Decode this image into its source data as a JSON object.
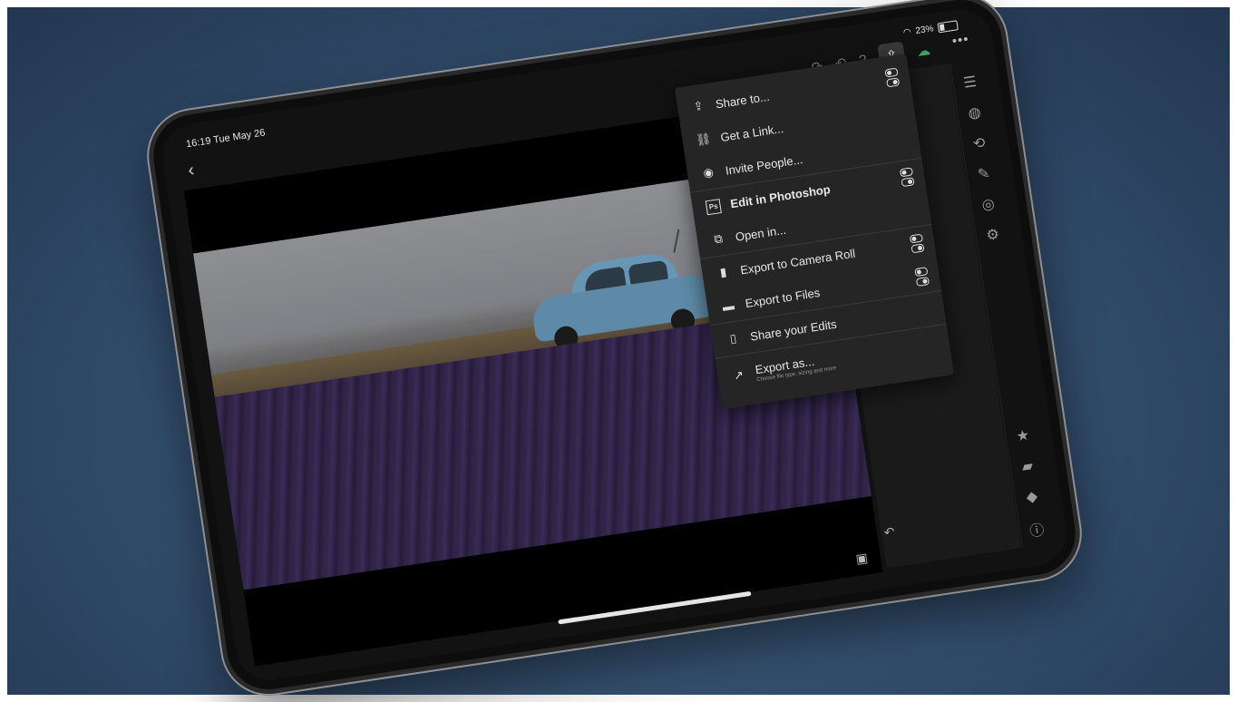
{
  "status": {
    "time": "16:19",
    "date": "Tue May 26",
    "battery": "23%"
  },
  "toolbar": {
    "redo": "↷",
    "undo": "↶",
    "help": "?",
    "share": "⇪",
    "more": "•••"
  },
  "menu": {
    "items": [
      {
        "label": "Share to...",
        "icon": "share-icon",
        "glyph": "⇪"
      },
      {
        "label": "Get a Link...",
        "icon": "link-icon",
        "glyph": "⛓"
      },
      {
        "label": "Invite People...",
        "icon": "invite-people-icon",
        "glyph": "◉"
      },
      {
        "label": "Edit in Photoshop",
        "icon": "photoshop-icon",
        "glyph": "Ps"
      },
      {
        "label": "Open in...",
        "icon": "open-in-icon",
        "glyph": "⧉"
      },
      {
        "label": "Export to Camera Roll",
        "icon": "camera-roll-icon",
        "glyph": "▮"
      },
      {
        "label": "Export to Files",
        "icon": "folder-icon",
        "glyph": "▬"
      },
      {
        "label": "Share your Edits",
        "icon": "share-edits-icon",
        "glyph": "▯"
      },
      {
        "label": "Export as...",
        "sub": "Choose file type, sizing and more",
        "icon": "export-as-icon",
        "glyph": "↗"
      }
    ]
  },
  "rail": [
    "sliders-icon",
    "heal-icon",
    "crop-icon",
    "brush-icon",
    "radial-icon",
    "adjust-icon"
  ],
  "rail_bottom": [
    "star-icon",
    "comment-icon",
    "tag-icon",
    "info-icon"
  ],
  "colors": {
    "background": "#34506f",
    "cloud": "#3fa45a",
    "menu": "#252525"
  }
}
